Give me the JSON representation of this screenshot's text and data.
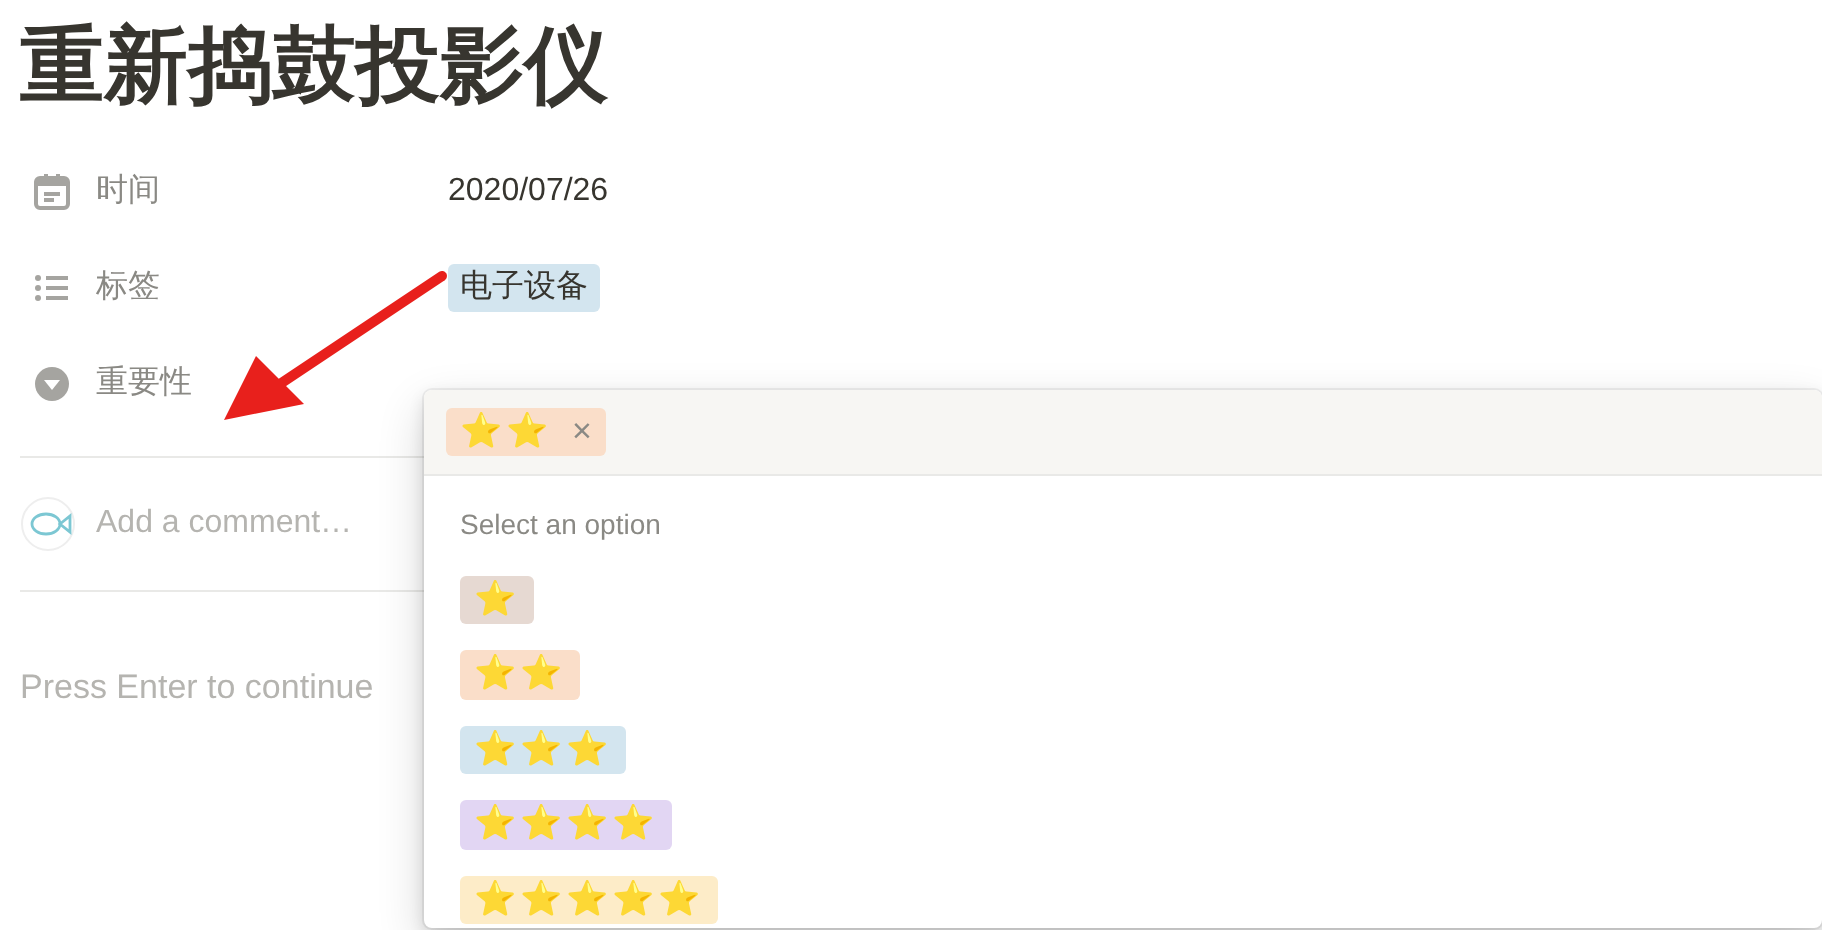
{
  "title": "重新捣鼓投影仪",
  "properties": [
    {
      "kind": "date",
      "label": "时间",
      "value": "2020/07/26"
    },
    {
      "kind": "tags",
      "label": "标签",
      "tags": [
        {
          "text": "电子设备",
          "color": "#d3e5ef"
        }
      ]
    },
    {
      "kind": "select",
      "label": "重要性"
    }
  ],
  "comment": {
    "placeholder": "Add a comment…"
  },
  "body": {
    "placeholder": "Press Enter to continue"
  },
  "dropdown": {
    "selected": [
      {
        "label": "⭐⭐",
        "color": "#fadec9",
        "remove": "×"
      }
    ],
    "hint": "Select an option",
    "options": [
      {
        "label": "⭐",
        "color": "#e6d9d2"
      },
      {
        "label": "⭐⭐",
        "color": "#fadec9"
      },
      {
        "label": "⭐⭐⭐",
        "color": "#d3e5ef"
      },
      {
        "label": "⭐⭐⭐⭐",
        "color": "#e2d6f3"
      },
      {
        "label": "⭐⭐⭐⭐⭐",
        "color": "#fdecc8"
      }
    ]
  }
}
